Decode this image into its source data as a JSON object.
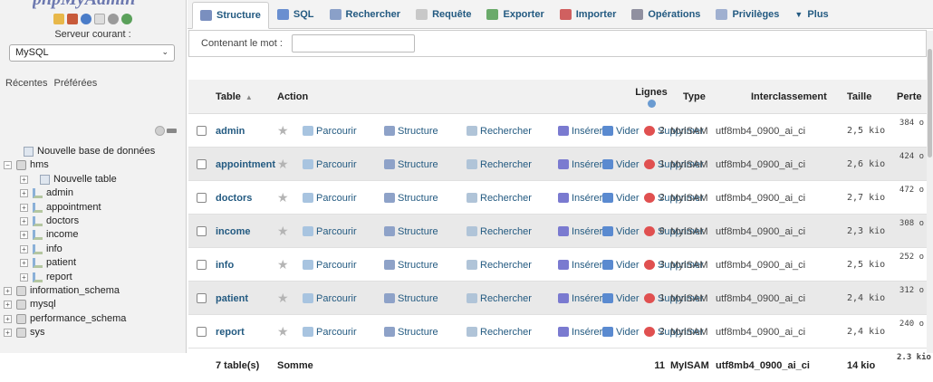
{
  "sidebar": {
    "logo_text": "phpMyAdmin",
    "server_label": "Serveur courant :",
    "server_value": "MySQL",
    "tabs": [
      "Récentes",
      "Préférées"
    ],
    "tree": [
      {
        "label": "Nouvelle base de données",
        "level": 0,
        "icon": "new-icon"
      },
      {
        "label": "hms",
        "level": 0,
        "icon": "database-icon",
        "expanded": true
      },
      {
        "label": "Nouvelle table",
        "level": 1,
        "icon": "new-icon"
      },
      {
        "label": "admin",
        "level": 1,
        "icon": "table-icon"
      },
      {
        "label": "appointment",
        "level": 1,
        "icon": "table-icon"
      },
      {
        "label": "doctors",
        "level": 1,
        "icon": "table-icon"
      },
      {
        "label": "income",
        "level": 1,
        "icon": "table-icon"
      },
      {
        "label": "info",
        "level": 1,
        "icon": "table-icon"
      },
      {
        "label": "patient",
        "level": 1,
        "icon": "table-icon"
      },
      {
        "label": "report",
        "level": 1,
        "icon": "table-icon"
      },
      {
        "label": "information_schema",
        "level": 0,
        "icon": "database-icon"
      },
      {
        "label": "mysql",
        "level": 0,
        "icon": "database-icon"
      },
      {
        "label": "performance_schema",
        "level": 0,
        "icon": "database-icon"
      },
      {
        "label": "sys",
        "level": 0,
        "icon": "database-icon"
      }
    ]
  },
  "topnav": {
    "tabs": [
      {
        "label": "Structure",
        "icon": "structure-icon",
        "active": true
      },
      {
        "label": "SQL",
        "icon": "sql-icon"
      },
      {
        "label": "Rechercher",
        "icon": "search-icon"
      },
      {
        "label": "Requête",
        "icon": "query-icon"
      },
      {
        "label": "Exporter",
        "icon": "export-icon"
      },
      {
        "label": "Importer",
        "icon": "import-icon"
      },
      {
        "label": "Opérations",
        "icon": "wrench-icon"
      },
      {
        "label": "Privilèges",
        "icon": "privileges-icon"
      },
      {
        "label": "Plus",
        "icon": "chevron-down-icon"
      }
    ]
  },
  "filter": {
    "label": "Contenant le mot :",
    "value": ""
  },
  "table": {
    "headers": {
      "table": "Table",
      "action": "Action",
      "rows": "Lignes",
      "type": "Type",
      "collation": "Interclassement",
      "size": "Taille",
      "overhead": "Perte"
    },
    "actions": {
      "browse": "Parcourir",
      "structure": "Structure",
      "search": "Rechercher",
      "insert": "Insérer",
      "empty": "Vider",
      "drop": "Supprimer"
    },
    "rows": [
      {
        "name": "admin",
        "rows": "2",
        "type": "MyISAM",
        "collation": "utf8mb4_0900_ai_ci",
        "size": "2,5 kio",
        "overhead": "384 o"
      },
      {
        "name": "appointment",
        "rows": "1",
        "type": "MyISAM",
        "collation": "utf8mb4_0900_ai_ci",
        "size": "2,6 kio",
        "overhead": "424 o"
      },
      {
        "name": "doctors",
        "rows": "2",
        "type": "MyISAM",
        "collation": "utf8mb4_0900_ai_ci",
        "size": "2,7 kio",
        "overhead": "472 o"
      },
      {
        "name": "income",
        "rows": "0",
        "type": "MyISAM",
        "collation": "utf8mb4_0900_ai_ci",
        "size": "2,3 kio",
        "overhead": "308 o"
      },
      {
        "name": "info",
        "rows": "3",
        "type": "MyISAM",
        "collation": "utf8mb4_0900_ai_ci",
        "size": "2,5 kio",
        "overhead": "252 o"
      },
      {
        "name": "patient",
        "rows": "1",
        "type": "MyISAM",
        "collation": "utf8mb4_0900_ai_ci",
        "size": "2,4 kio",
        "overhead": "312 o"
      },
      {
        "name": "report",
        "rows": "2",
        "type": "MyISAM",
        "collation": "utf8mb4_0900_ai_ci",
        "size": "2,4 kio",
        "overhead": "240 o"
      }
    ],
    "footer": {
      "count": "7 table(s)",
      "sum_label": "Somme",
      "rows": "11",
      "type": "MyISAM",
      "collation": "utf8mb4_0900_ai_ci",
      "size": "14 kio",
      "overhead": "2.3 kio"
    }
  },
  "colors": {
    "link": "#235a81",
    "sidebar_bg": "#f2f2f2",
    "row_alt": "#e9e9e9",
    "drop": "#e05050"
  }
}
